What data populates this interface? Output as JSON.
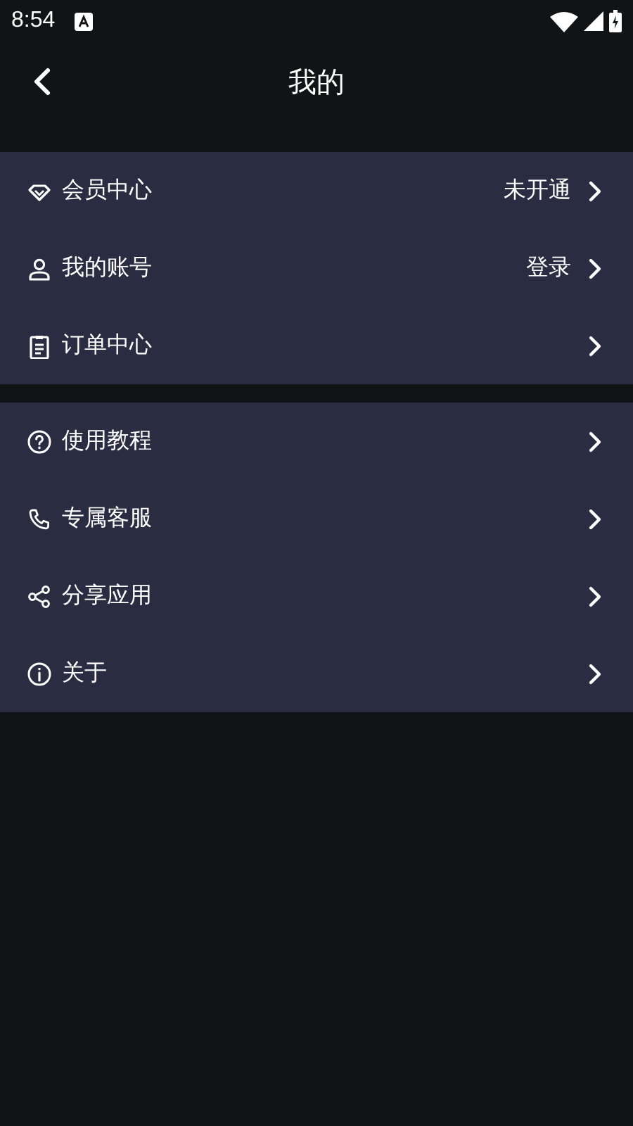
{
  "status_bar": {
    "time": "8:54"
  },
  "header": {
    "title": "我的"
  },
  "sections": [
    {
      "items": [
        {
          "label": "会员中心",
          "value": "未开通"
        },
        {
          "label": "我的账号",
          "value": "登录"
        },
        {
          "label": "订单中心"
        }
      ]
    },
    {
      "items": [
        {
          "label": "使用教程"
        },
        {
          "label": "专属客服"
        },
        {
          "label": "分享应用"
        },
        {
          "label": "关于"
        }
      ]
    }
  ]
}
